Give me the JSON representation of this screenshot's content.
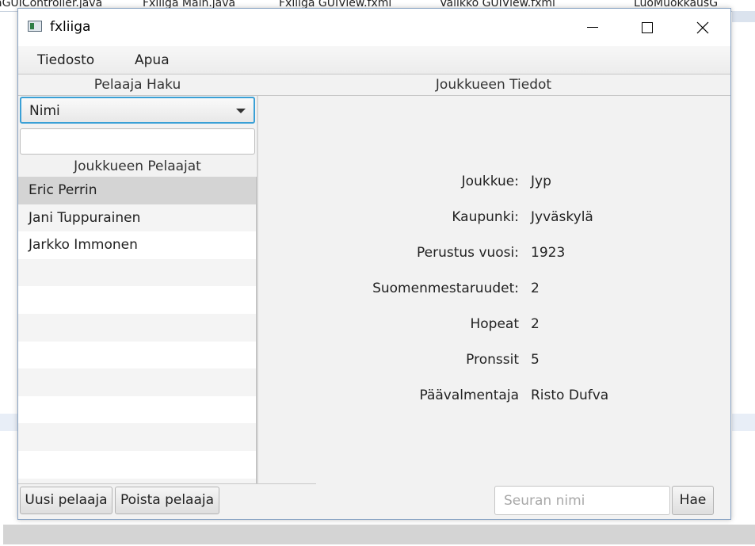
{
  "background": {
    "tabs": [
      "aGUIController.java",
      "Fxliiga Main.java",
      "Fxliiga GUIView.fxml",
      "Valikko GUIView.fxml",
      "LuoMuokkausG"
    ]
  },
  "window": {
    "title": "fxliiga",
    "menu": [
      "Tiedosto",
      "Apua"
    ]
  },
  "left": {
    "heading": "Pelaaja Haku",
    "combo_value": "Nimi",
    "search_value": "",
    "list_heading": "Joukkueen Pelaajat",
    "players": [
      "Eric Perrin",
      "Jani Tuppurainen",
      "Jarkko Immonen"
    ],
    "selected_index": 0,
    "add_button": "Uusi pelaaja",
    "remove_button": "Poista pelaaja"
  },
  "details": {
    "heading": "Joukkueen Tiedot",
    "rows": [
      {
        "label": "Joukkue:",
        "value": "Jyp"
      },
      {
        "label": "Kaupunki:",
        "value": "Jyväskylä"
      },
      {
        "label": "Perustus vuosi:",
        "value": "1923"
      },
      {
        "label": "Suomenmestaruudet:",
        "value": "2"
      },
      {
        "label": "Hopeat",
        "value": "2"
      },
      {
        "label": "Pronssit",
        "value": "5"
      },
      {
        "label": "Päävalmentaja",
        "value": "Risto Dufva"
      }
    ]
  },
  "search": {
    "placeholder": "Seuran nimi",
    "button": "Hae"
  }
}
